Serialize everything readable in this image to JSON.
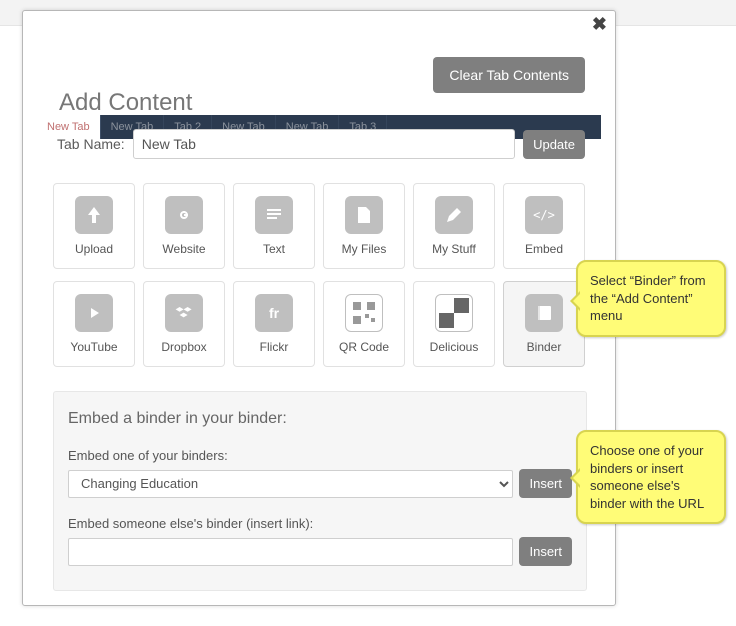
{
  "header": {
    "title": "Add Content",
    "clear_btn": "Clear Tab Contents"
  },
  "tabs_bg": [
    "New Tab",
    "New Tab",
    "Tab 2",
    "New Tab",
    "New Tab",
    "Tab 3"
  ],
  "tabname": {
    "label": "Tab Name:",
    "value": "New Tab",
    "update": "Update"
  },
  "tiles": [
    {
      "label": "Upload",
      "icon": "upload-icon"
    },
    {
      "label": "Website",
      "icon": "link-icon"
    },
    {
      "label": "Text",
      "icon": "text-icon"
    },
    {
      "label": "My Files",
      "icon": "file-icon"
    },
    {
      "label": "My Stuff",
      "icon": "pen-icon"
    },
    {
      "label": "Embed",
      "icon": "embed-icon"
    },
    {
      "label": "YouTube",
      "icon": "youtube-icon"
    },
    {
      "label": "Dropbox",
      "icon": "dropbox-icon"
    },
    {
      "label": "Flickr",
      "icon": "flickr-icon"
    },
    {
      "label": "QR Code",
      "icon": "qrcode-icon"
    },
    {
      "label": "Delicious",
      "icon": "delicious-icon"
    },
    {
      "label": "Binder",
      "icon": "binder-icon",
      "selected": true
    }
  ],
  "panel": {
    "heading": "Embed a binder in your binder:",
    "own_label": "Embed one of your binders:",
    "own_selected": "Changing Education",
    "insert": "Insert",
    "other_label": "Embed someone else's binder (insert link):",
    "other_value": ""
  },
  "callouts": {
    "c1": "Select “Binder” from the “Add Content” menu",
    "c2": "Choose one of your binders or insert someone else's binder with the URL"
  }
}
